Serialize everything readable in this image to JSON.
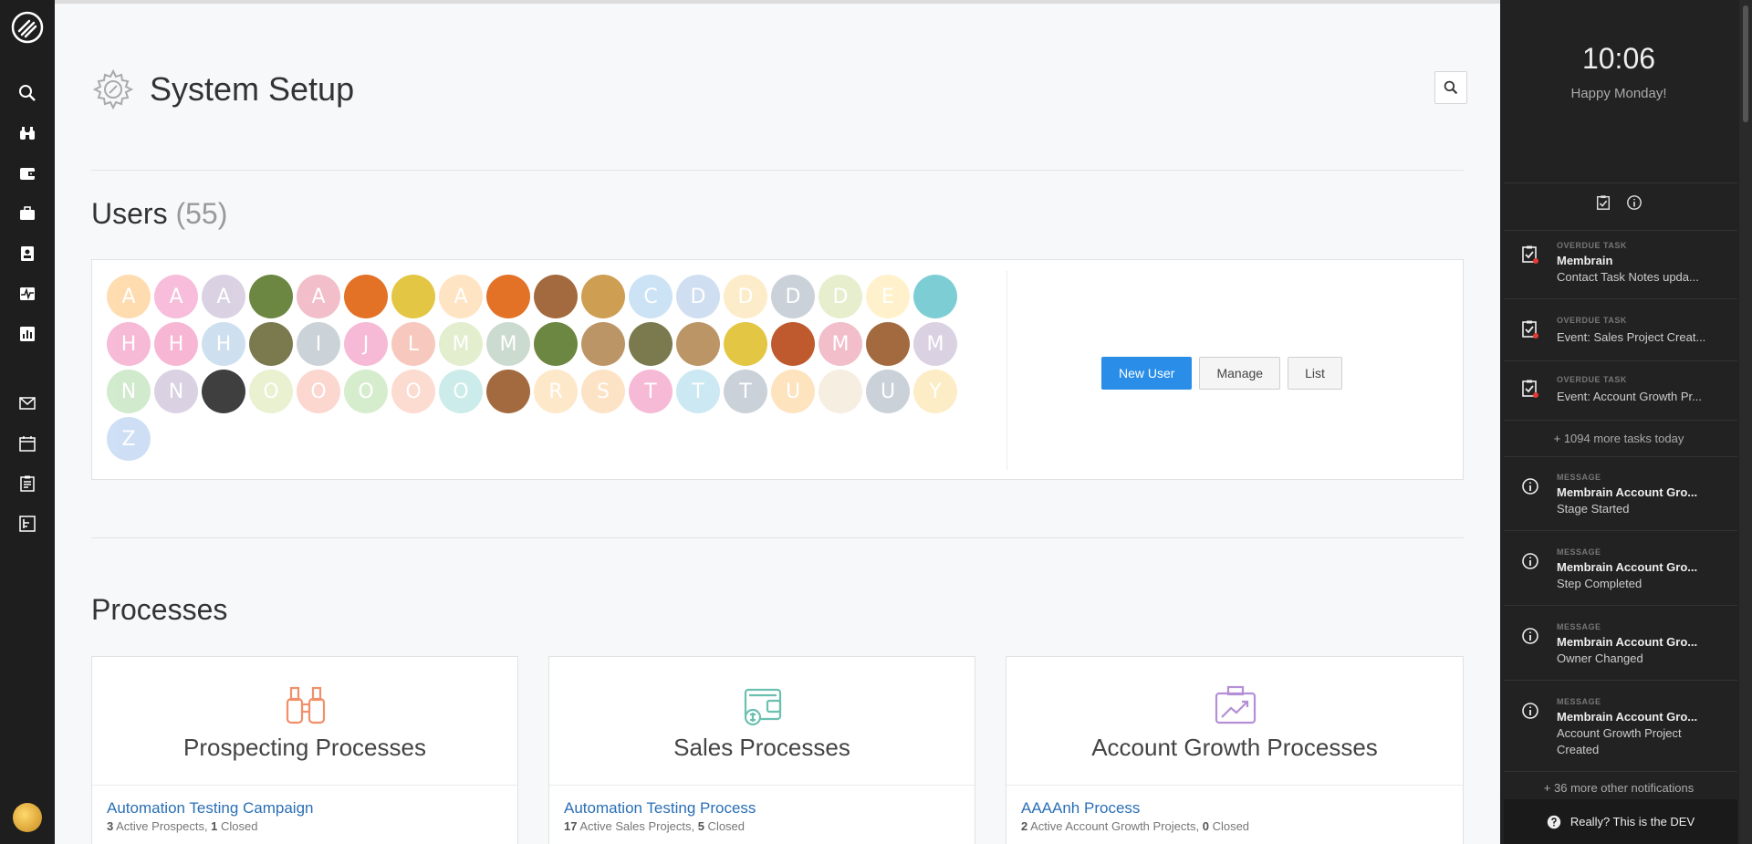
{
  "nav": {
    "icons": [
      "search-icon",
      "binoculars-icon",
      "wallet-icon",
      "briefcase-icon",
      "contact-card-icon",
      "activity-icon",
      "report-icon",
      "mail-icon",
      "calendar-icon",
      "clipboard-icon",
      "chart-board-icon"
    ]
  },
  "page": {
    "title": "System Setup"
  },
  "users": {
    "heading": "Users",
    "count": "(55)",
    "avatars": [
      {
        "l": "A",
        "c": "#ffd9a8"
      },
      {
        "l": "A",
        "c": "#f7b6d8"
      },
      {
        "l": "A",
        "c": "#d7cde0"
      },
      {
        "l": "",
        "c": "#5b7a2c"
      },
      {
        "l": "A",
        "c": "#f0b8c4"
      },
      {
        "l": "",
        "c": "#e0620e"
      },
      {
        "l": "",
        "c": "#e0c030"
      },
      {
        "l": "A",
        "c": "#ffe2bd"
      },
      {
        "l": "",
        "c": "#e0620e"
      },
      {
        "l": "",
        "c": "#9a5a2a"
      },
      {
        "l": "",
        "c": "#c9953f"
      },
      {
        "l": "C",
        "c": "#c7e0f5"
      },
      {
        "l": "D",
        "c": "#cadcf0"
      },
      {
        "l": "D",
        "c": "#fdebc5"
      },
      {
        "l": "D",
        "c": "#c5cdd4"
      },
      {
        "l": "D",
        "c": "#e4edc9"
      },
      {
        "l": "E",
        "c": "#fff0c6"
      },
      {
        "l": "",
        "c": "#6fc9cf"
      },
      {
        "l": "H",
        "c": "#f6b3d3"
      },
      {
        "l": "H",
        "c": "#f7b0d0"
      },
      {
        "l": "H",
        "c": "#c9dcef"
      },
      {
        "l": "",
        "c": "#6b6b3b"
      },
      {
        "l": "I",
        "c": "#c7cfd4"
      },
      {
        "l": "J",
        "c": "#f6b3d3"
      },
      {
        "l": "L",
        "c": "#f7c3b6"
      },
      {
        "l": "M",
        "c": "#dfedc8"
      },
      {
        "l": "M",
        "c": "#c7d8cc"
      },
      {
        "l": "",
        "c": "#5b7a2c"
      },
      {
        "l": "",
        "c": "#b58a55"
      },
      {
        "l": "",
        "c": "#6b6b3b"
      },
      {
        "l": "",
        "c": "#b58a55"
      },
      {
        "l": "",
        "c": "#e0c030"
      },
      {
        "l": "",
        "c": "#b84818"
      },
      {
        "l": "M",
        "c": "#f0b8c4"
      },
      {
        "l": "",
        "c": "#9a5a2a"
      },
      {
        "l": "M",
        "c": "#d7cde0"
      },
      {
        "l": "N",
        "c": "#cde8c8"
      },
      {
        "l": "N",
        "c": "#d7cde0"
      },
      {
        "l": "",
        "c": "#2a2a2a"
      },
      {
        "l": "O",
        "c": "#e7f0cc"
      },
      {
        "l": "O",
        "c": "#fbd3cc"
      },
      {
        "l": "O",
        "c": "#d2ecc8"
      },
      {
        "l": "O",
        "c": "#fcd8cc"
      },
      {
        "l": "O",
        "c": "#c6ebe8"
      },
      {
        "l": "",
        "c": "#9a5a2a"
      },
      {
        "l": "R",
        "c": "#fde6c4"
      },
      {
        "l": "S",
        "c": "#fde0c0"
      },
      {
        "l": "T",
        "c": "#f6b3d3"
      },
      {
        "l": "T",
        "c": "#c6e6f2"
      },
      {
        "l": "T",
        "c": "#c5cdd4"
      },
      {
        "l": "U",
        "c": "#fde0b8"
      },
      {
        "l": "",
        "c": "#f5ecdd"
      },
      {
        "l": "U",
        "c": "#c5cdd4"
      },
      {
        "l": "Y",
        "c": "#fdecc2"
      },
      {
        "l": "Z",
        "c": "#c9dcf5"
      }
    ],
    "actions": {
      "new_user": "New User",
      "manage": "Manage",
      "list": "List"
    }
  },
  "processes": {
    "heading": "Processes",
    "cards": [
      {
        "title": "Prospecting Processes",
        "icon": "binoculars-icon",
        "color": "#f0906a",
        "link": "Automation Testing Campaign",
        "meta_a": "3",
        "meta_a_label": " Active Prospects, ",
        "meta_b": "1",
        "meta_b_label": " Closed"
      },
      {
        "title": "Sales Processes",
        "icon": "wallet-icon",
        "color": "#6cc0b0",
        "link": "Automation Testing Process",
        "meta_a": "17",
        "meta_a_label": " Active Sales Projects, ",
        "meta_b": "5",
        "meta_b_label": " Closed"
      },
      {
        "title": "Account Growth Processes",
        "icon": "briefcase-icon",
        "color": "#b58fd6",
        "link": "AAAAnh Process",
        "meta_a": "2",
        "meta_a_label": " Active Account Growth Projects, ",
        "meta_b": "0",
        "meta_b_label": " Closed"
      }
    ]
  },
  "panel": {
    "time": "10:06",
    "greeting": "Happy Monday!",
    "notifications": [
      {
        "type": "OVERDUE TASK",
        "title": "Membrain",
        "sub": "Contact Task Notes upda...",
        "kind": "task"
      },
      {
        "type": "OVERDUE TASK",
        "title": "",
        "sub": "Event: Sales Project Creat...",
        "kind": "task"
      },
      {
        "type": "OVERDUE TASK",
        "title": "",
        "sub": "Event: Account Growth Pr...",
        "kind": "task"
      }
    ],
    "more_tasks": "+ 1094 more tasks today",
    "messages": [
      {
        "type": "MESSAGE",
        "title": "Membrain Account Gro...",
        "sub": "Stage Started",
        "sub2": ""
      },
      {
        "type": "MESSAGE",
        "title": "Membrain Account Gro...",
        "sub": "Step Completed",
        "sub2": ""
      },
      {
        "type": "MESSAGE",
        "title": "Membrain Account Gro...",
        "sub": "Owner Changed",
        "sub2": ""
      },
      {
        "type": "MESSAGE",
        "title": "Membrain Account Gro...",
        "sub": "Account Growth Project",
        "sub2": "Created"
      }
    ],
    "more_notifications": "+ 36 more other notifications",
    "dev_label": "Really? This is the DEV"
  }
}
